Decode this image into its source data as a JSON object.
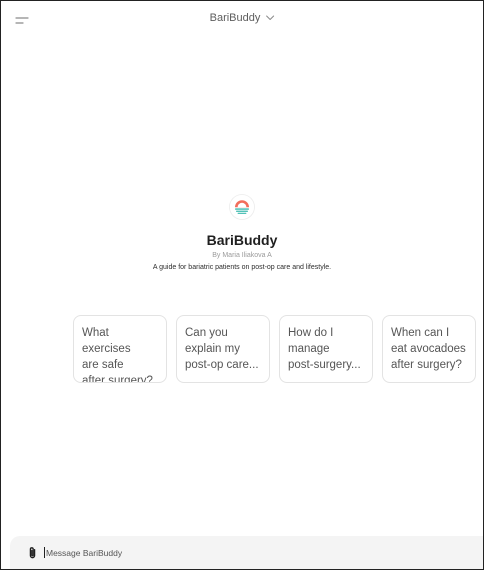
{
  "header": {
    "title": "BariBuddy",
    "menu_icon": "hamburger-menu-icon",
    "dropdown_icon": "chevron-down-icon"
  },
  "hero": {
    "logo_icon": "sunset-logo-icon",
    "name": "BariBuddy",
    "author": "By Maria Iliakova A",
    "description": "A guide for bariatric patients on post-op care and lifestyle."
  },
  "suggestions": [
    {
      "label": "What exercises\nare safe\nafter surgery?"
    },
    {
      "label": "Can you\nexplain my\npost-op care..."
    },
    {
      "label": "How do I\nmanage\npost-surgery..."
    },
    {
      "label": "When can I\neat avocadoes\nafter surgery?"
    }
  ],
  "composer": {
    "placeholder": "Message BariBuddy",
    "attach_icon": "paperclip-icon"
  },
  "colors": {
    "logo_coral": "#f26e5c",
    "logo_teal": "#3bb9ae",
    "composer_bg": "#f4f4f4",
    "card_border": "#e3e3e3"
  }
}
